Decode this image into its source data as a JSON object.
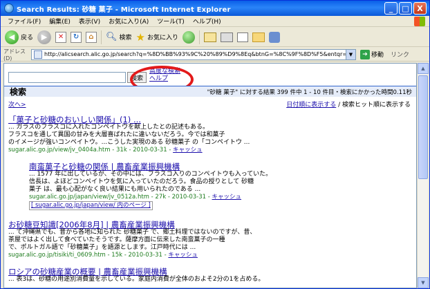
{
  "window": {
    "title": "Search Results: 砂糖 菓子 - Microsoft Internet Explorer",
    "buttons": {
      "minimize": "_",
      "maximize": "□",
      "close": "X"
    }
  },
  "menubar": {
    "items": [
      "ファイル(F)",
      "編集(E)",
      "表示(V)",
      "お気に入り(A)",
      "ツール(T)",
      "ヘルプ(H)"
    ]
  },
  "toolbar": {
    "back_label": "戻る",
    "search_label": "検索",
    "favorites_label": "お気に入り"
  },
  "addressbar": {
    "label": "アドレス(D)",
    "url": "http://alicsearch.alic.go.jp/search?q=%8D%BB%93%9C%20%89%D9%8Eq&btnG=%8C%9F%8D%F5&entqr=0&output=xml_no",
    "go_label": "移動",
    "links_label": "リンク"
  },
  "search": {
    "query_value": "",
    "button_label": "検索",
    "advanced_label": "高度な検索",
    "help_label": "ヘルプ"
  },
  "results_header": {
    "title": "検索",
    "stats": "\"砂糖 菓子\" に対する結果 399 件中 1 - 10 件目・検索にかかった時間0.11秒"
  },
  "nav": {
    "next_label": "次へ>",
    "sort_date_label": "日付順に表示する",
    "sort_sep": " / ",
    "sort_relevance_label": "検索ヒット順に表示する"
  },
  "results": [
    {
      "title": "「菓子と砂糖のおいしい関係」(1) ...",
      "snippets": [
        "... ガラスのフラスコに入れたコンペイトウを献上したとの記述もある。",
        "フラスコを通して異国の甘みを大層喜ばれたに違いないだろう。今では和菓子",
        "のイメージが強いコンペイトウ。...こうした実現のある 砂糖菓子 の「コンペイトウ ..."
      ],
      "url": "sugar.alic.go.jp/view/jv_0404a.htm - 31k - 2010-03-31 - ",
      "cache": "キャッシュ"
    },
    {
      "title": "南蛮菓子と砂糖の関係 | 農畜産業振興機構",
      "snippets": [
        "... 1577 年に出しているが、その中には、フラスコ入りのコンペイトウも入っていた。",
        "信長は、よほどコンペイトウを気に入っていたのだろう。食品の授りとして 砂糖",
        "菓子 は、最も心配がなく良い結果にも用いられたのである ..."
      ],
      "url": "sugar.alic.go.jp/japan/view/jv_0512a.htm - 27k - 2010-03-31 - ",
      "cache": "キャッシュ",
      "more": "[ sugar.alic.go.jp/japan/view/ 内のページ ]"
    },
    {
      "title": "お砂糖豆知識[2006年8月] | 農畜産業振興機構",
      "snippets": [
        "... て沖縄県でも、昔から各地に知られた 砂糖菓子 で、郷土料理ではないのですが、昔、",
        "茶屋ではよく出して食べていたそうです。薩摩方面に伝来した南蛮菓子の一種",
        "で、ポルトガル語で「砂糖菓子」を語源とします。江戸時代には ..."
      ],
      "url": "sugar.alic.go.jp/tisiki/ti_0609.htm - 15k - 2010-03-31 - ",
      "cache": "キャッシュ"
    },
    {
      "title": "ロシアの砂糖産業の概要 | 農畜産業振興機構",
      "snippets": [
        "... 表3は、砂糖の用途別消費量を示している。家庭内消費が全体のおよそ2分の1を占める。"
      ]
    }
  ]
}
